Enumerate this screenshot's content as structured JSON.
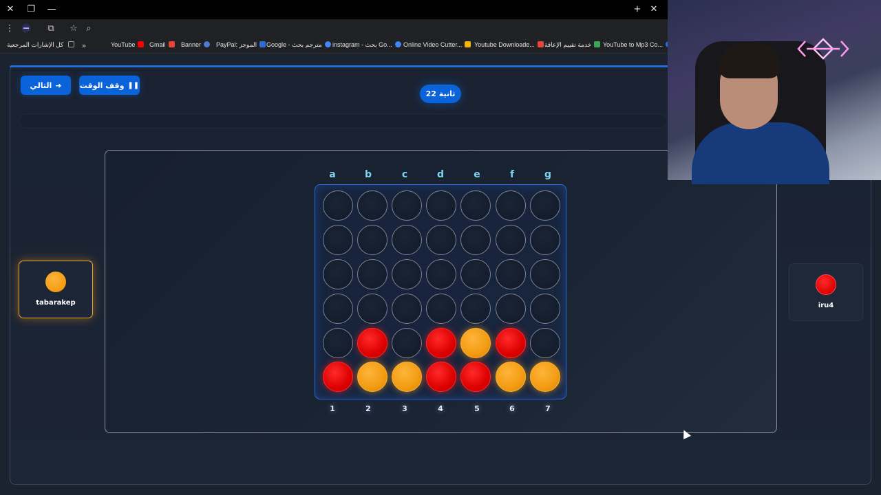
{
  "browser": {
    "titlebar_icons": [
      "close-icon",
      "restore-icon",
      "minimize-icon",
      "new-tab-icon",
      "close-tab-icon"
    ],
    "bookmarks": [
      {
        "label": "كل الإشارات المرجعية",
        "color": "#9aa0a6"
      },
      {
        "label": "YouTube",
        "color": "#ff0000"
      },
      {
        "label": "Gmail",
        "color": "#ea4335"
      },
      {
        "label": "Banner",
        "color": "#4a7bd0"
      },
      {
        "label": "PayPal: الموجز",
        "color": "#2b6cd6"
      },
      {
        "label": "Google - مترجم بحث",
        "color": "#4285f4"
      },
      {
        "label": "instagram - بحث Go...",
        "color": "#4285f4"
      },
      {
        "label": "Online Video Cutter...",
        "color": "#f4b400"
      },
      {
        "label": "Youtube Downloade...",
        "color": "#e8453c"
      },
      {
        "label": "خدمة تقييم الإعاقة",
        "color": "#3aa757"
      },
      {
        "label": "YouTube to Mp3 Co...",
        "color": "#1a73e8"
      }
    ]
  },
  "game": {
    "next_button": "التالي",
    "pause_button": "وقف الوقت",
    "timer": "22 ثانية",
    "column_letters": [
      "a",
      "b",
      "c",
      "d",
      "e",
      "f",
      "g"
    ],
    "column_numbers": [
      "1",
      "2",
      "3",
      "4",
      "5",
      "6",
      "7"
    ],
    "board": [
      [
        "empty",
        "empty",
        "empty",
        "empty",
        "empty",
        "empty",
        "empty"
      ],
      [
        "empty",
        "empty",
        "empty",
        "empty",
        "empty",
        "empty",
        "empty"
      ],
      [
        "empty",
        "empty",
        "empty",
        "empty",
        "empty",
        "empty",
        "empty"
      ],
      [
        "empty",
        "empty",
        "empty",
        "empty",
        "empty",
        "empty",
        "empty"
      ],
      [
        "empty",
        "red",
        "empty",
        "red",
        "yellow",
        "red",
        "empty"
      ],
      [
        "red",
        "yellow",
        "yellow",
        "red",
        "red",
        "yellow",
        "yellow"
      ]
    ],
    "players": {
      "left": {
        "name": "tabarakep",
        "color": "#f29c12"
      },
      "right": {
        "name": "iru4",
        "color": "#dd0000"
      }
    },
    "active_player": "left"
  },
  "colors": {
    "accent": "#0b63d9",
    "red_disc": "#dd0000",
    "yellow_disc": "#f29c12"
  }
}
